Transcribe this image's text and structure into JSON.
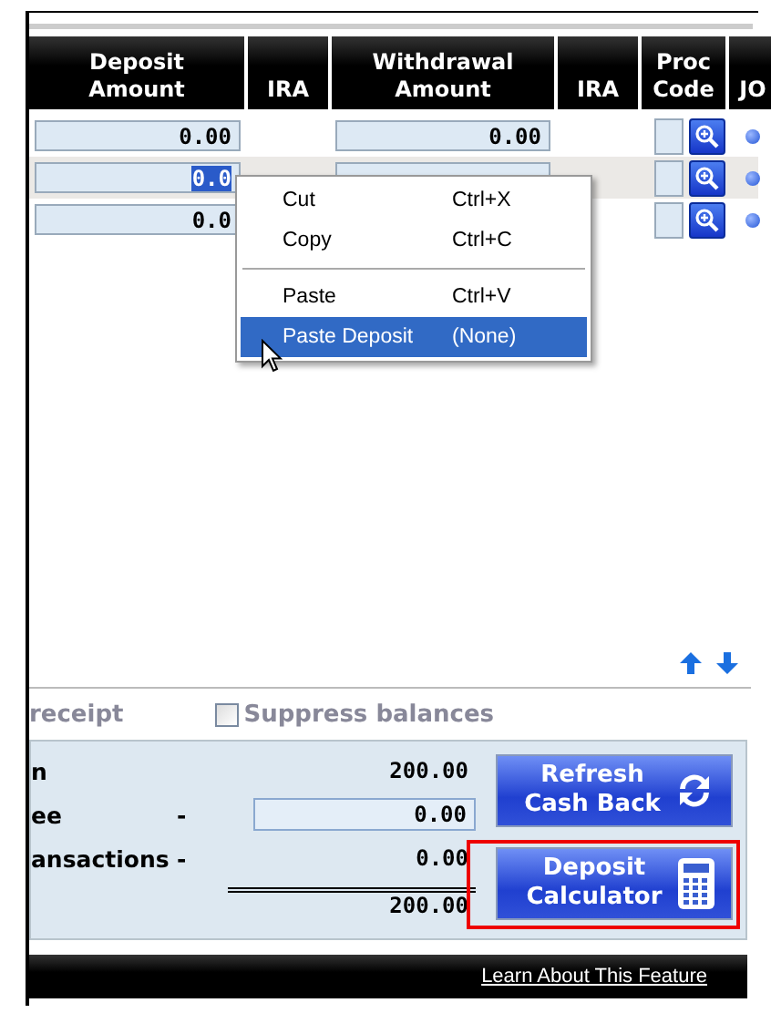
{
  "columns": [
    "Deposit Amount",
    "IRA",
    "Withdrawal Amount",
    "IRA",
    "Proc Code",
    "JO"
  ],
  "rows": [
    {
      "deposit": "0.00",
      "deposit_text_selected": false,
      "withdrawal": "0.00",
      "selected": false
    },
    {
      "deposit": "0.0",
      "deposit_text_selected": true,
      "selected": true
    },
    {
      "deposit": "0.0",
      "deposit_text_selected": false,
      "selected": false
    }
  ],
  "context_menu": [
    {
      "kind": "item",
      "label": "Cut",
      "shortcut": "Ctrl+X",
      "selected": false
    },
    {
      "kind": "item",
      "label": "Copy",
      "shortcut": "Ctrl+C",
      "selected": false
    },
    {
      "kind": "separator"
    },
    {
      "kind": "item",
      "label": "Paste",
      "shortcut": "Ctrl+V",
      "selected": false
    },
    {
      "kind": "item",
      "label": "Paste Deposit",
      "shortcut": "(None)",
      "selected": true
    }
  ],
  "options": {
    "receipt_label": "receipt",
    "suppress_balances": {
      "label": "Suppress balances",
      "checked": false
    }
  },
  "summary": [
    {
      "label": "n",
      "value": "200.00",
      "kind": "text"
    },
    {
      "label": "ee",
      "sign": "-",
      "value": "0.00",
      "kind": "field"
    },
    {
      "label": "ansactions",
      "sign": "-",
      "value": "0.00",
      "kind": "text"
    },
    {
      "value": "200.00",
      "kind": "total"
    }
  ],
  "buttons": [
    {
      "label": "Refresh Cash Back",
      "highlighted": false
    },
    {
      "label": "Deposit Calculator",
      "highlighted": true
    }
  ],
  "footer_link": "Learn About This Feature"
}
